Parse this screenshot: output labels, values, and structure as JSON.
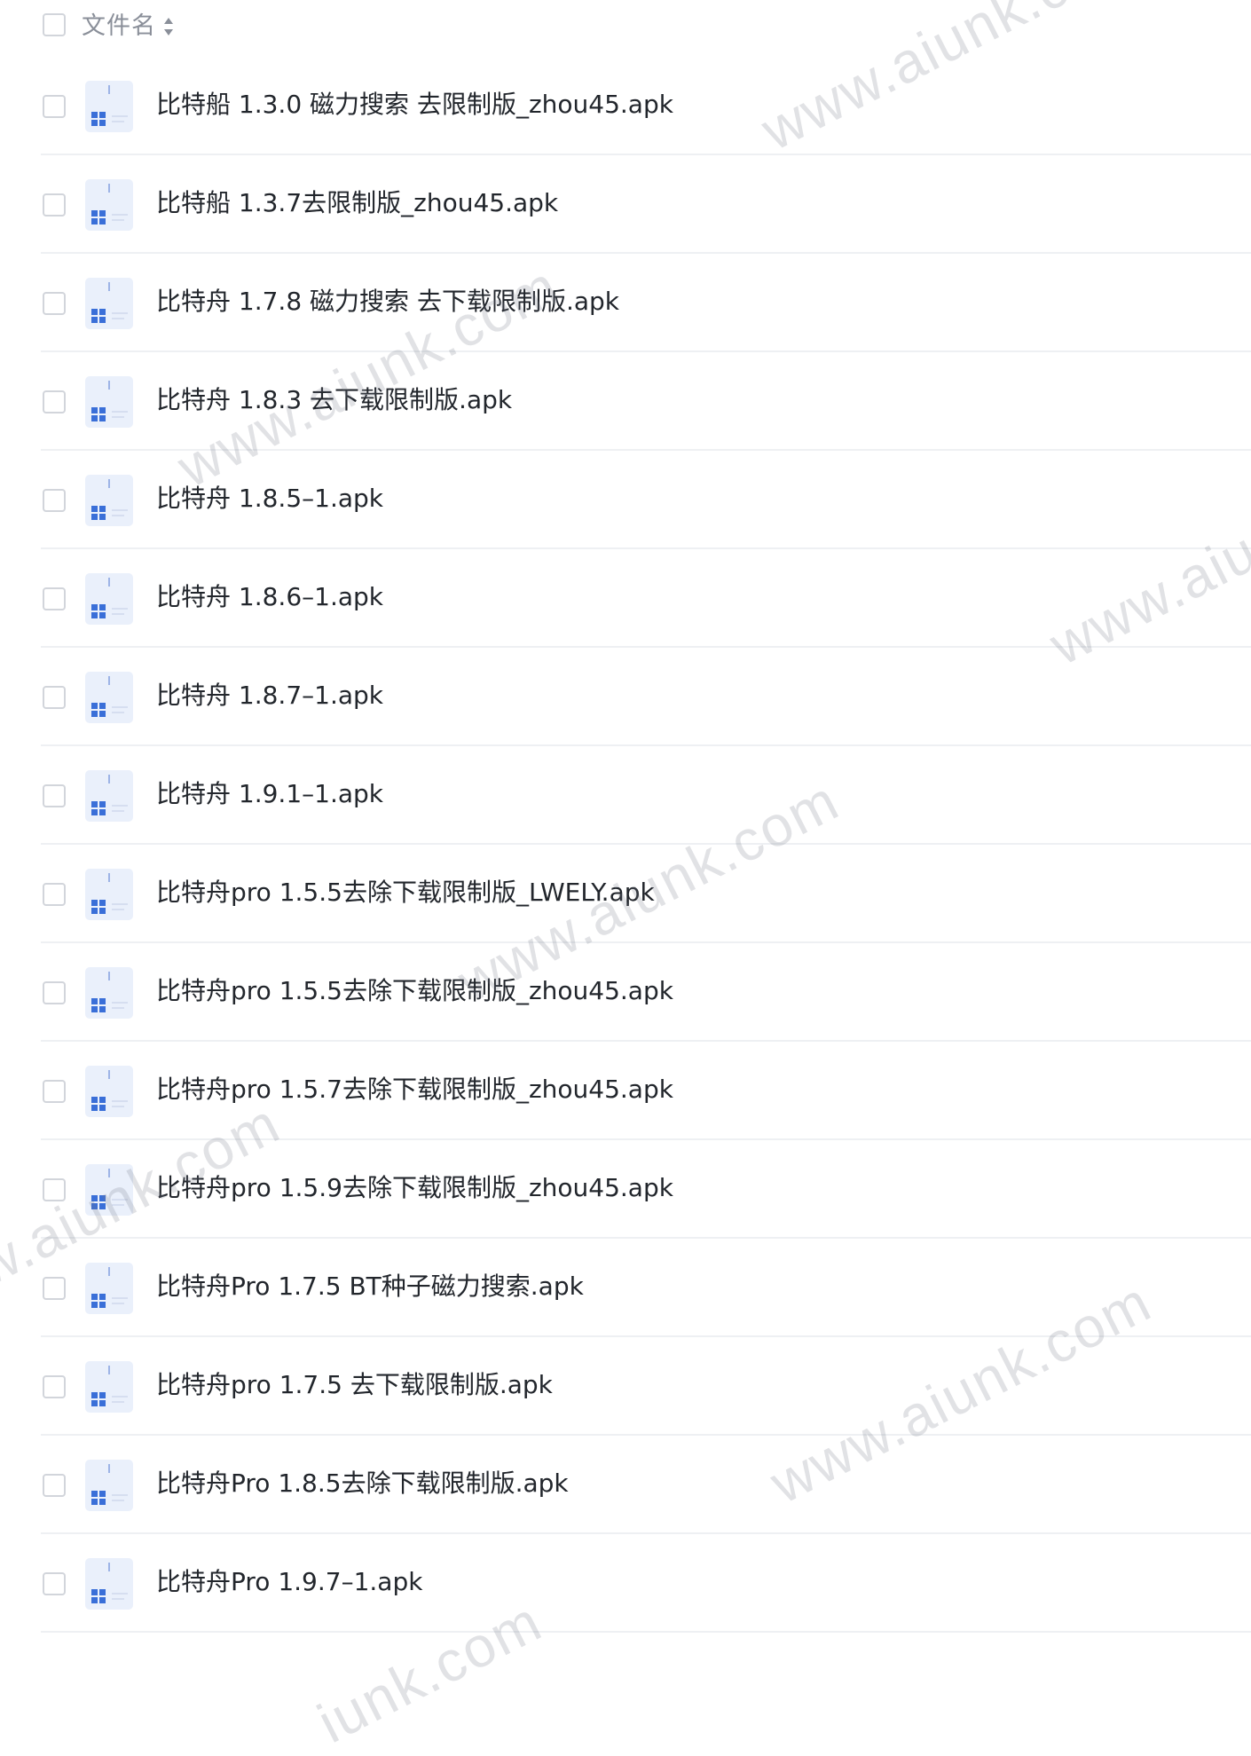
{
  "header": {
    "column_label": "文件名",
    "sort_icon": "sort-updown-icon"
  },
  "files": [
    {
      "name": "比特船 1.3.0 磁力搜索 去限制版_zhou45.apk",
      "icon": "apk-file-icon"
    },
    {
      "name": "比特船 1.3.7去限制版_zhou45.apk",
      "icon": "apk-file-icon"
    },
    {
      "name": "比特舟 1.7.8 磁力搜索 去下载限制版.apk",
      "icon": "apk-file-icon"
    },
    {
      "name": "比特舟 1.8.3 去下载限制版.apk",
      "icon": "apk-file-icon"
    },
    {
      "name": "比特舟 1.8.5–1.apk",
      "icon": "apk-file-icon"
    },
    {
      "name": "比特舟 1.8.6–1.apk",
      "icon": "apk-file-icon"
    },
    {
      "name": "比特舟 1.8.7–1.apk",
      "icon": "apk-file-icon"
    },
    {
      "name": "比特舟 1.9.1–1.apk",
      "icon": "apk-file-icon"
    },
    {
      "name": "比特舟pro 1.5.5去除下载限制版_LWELY.apk",
      "icon": "apk-file-icon"
    },
    {
      "name": "比特舟pro 1.5.5去除下载限制版_zhou45.apk",
      "icon": "apk-file-icon"
    },
    {
      "name": "比特舟pro 1.5.7去除下载限制版_zhou45.apk",
      "icon": "apk-file-icon"
    },
    {
      "name": "比特舟pro 1.5.9去除下载限制版_zhou45.apk",
      "icon": "apk-file-icon"
    },
    {
      "name": "比特舟Pro 1.7.5 BT种子磁力搜索.apk",
      "icon": "apk-file-icon"
    },
    {
      "name": "比特舟pro 1.7.5 去下载限制版.apk",
      "icon": "apk-file-icon"
    },
    {
      "name": "比特舟Pro 1.8.5去除下载限制版.apk",
      "icon": "apk-file-icon"
    },
    {
      "name": "比特舟Pro 1.9.7–1.apk",
      "icon": "apk-file-icon"
    }
  ],
  "watermarks": [
    {
      "text": "www.aiunk.co"
    },
    {
      "text": "www.aiunk.com"
    },
    {
      "text": "www.aiu"
    },
    {
      "text": "www.aiunk.com"
    },
    {
      "text": "w.aiunk.com"
    },
    {
      "text": "www.aiunk.com"
    },
    {
      "text": "iunk.com"
    }
  ],
  "colors": {
    "text": "#22262c",
    "header_text": "#8a8f99",
    "divider": "#eef0f3",
    "checkbox_border": "#d2d5db",
    "icon_blue": "#3a6fd8",
    "icon_bg": "#eaf0fb"
  }
}
